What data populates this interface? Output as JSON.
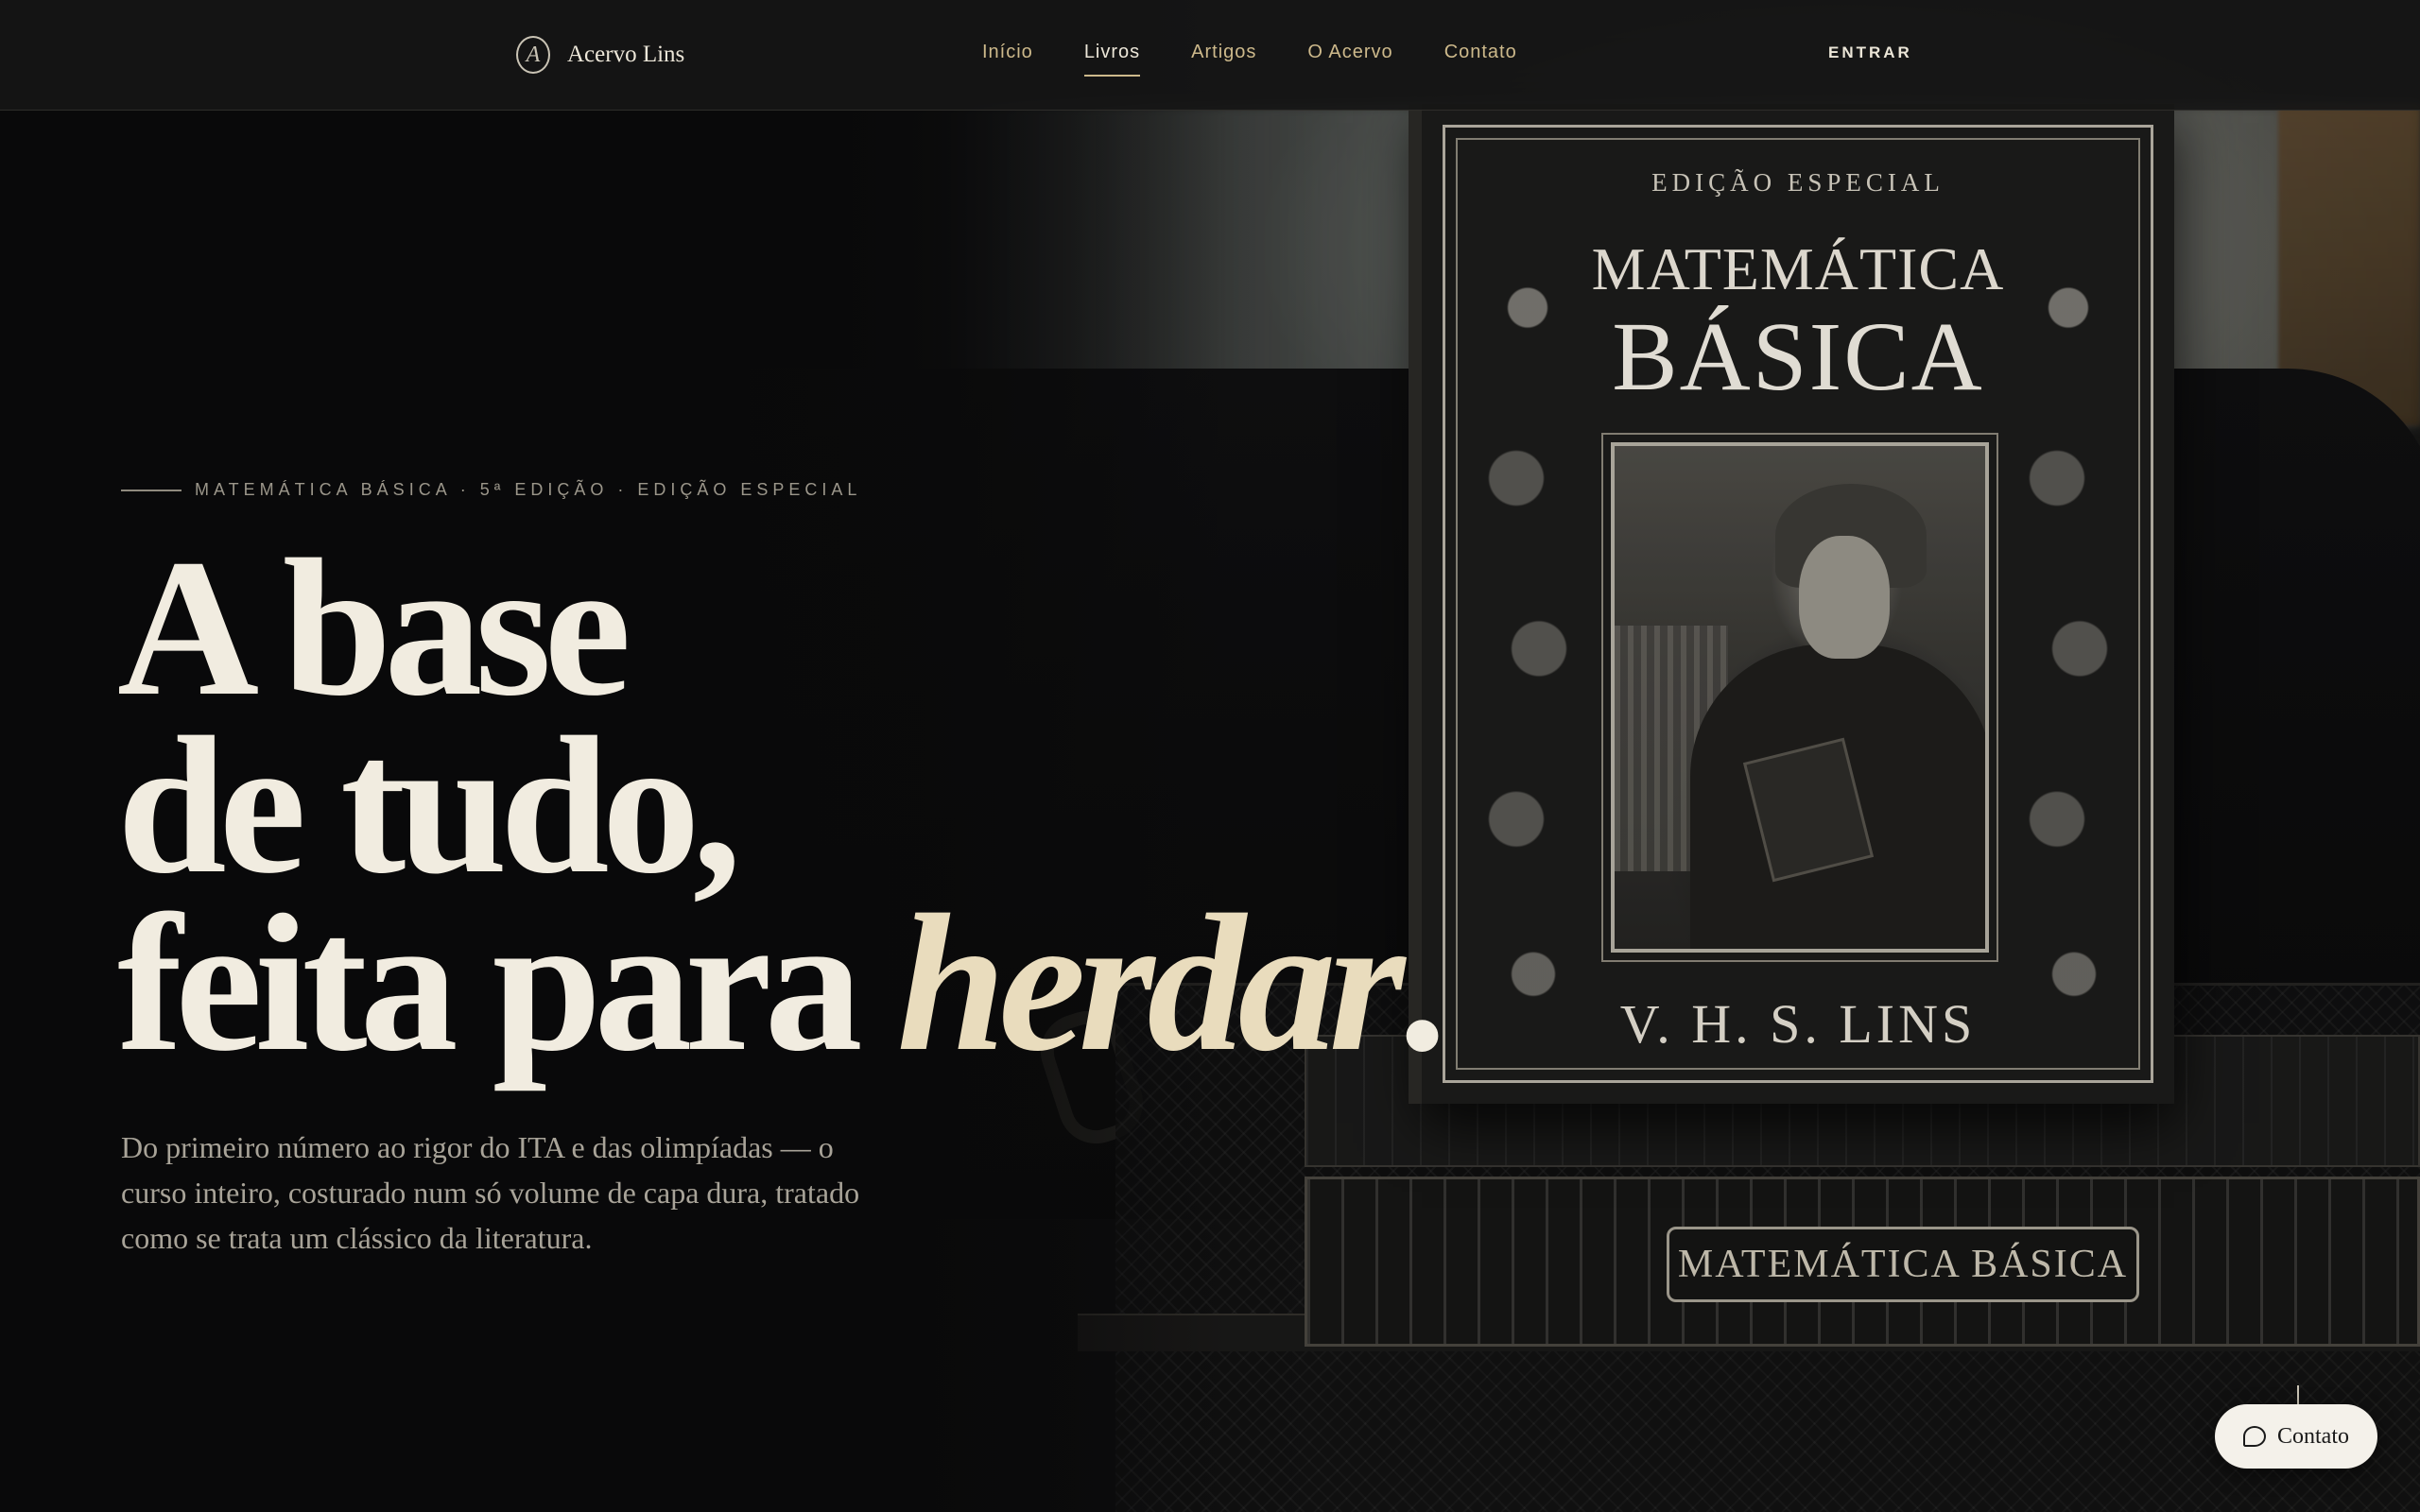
{
  "header": {
    "brand_name": "Acervo Lins",
    "nav": [
      {
        "label": "Início",
        "active": false
      },
      {
        "label": "Livros",
        "active": true
      },
      {
        "label": "Artigos",
        "active": false
      },
      {
        "label": "O Acervo",
        "active": false
      },
      {
        "label": "Contato",
        "active": false
      }
    ],
    "login_label": "ENTRAR"
  },
  "hero": {
    "eyebrow": "MATEMÁTICA BÁSICA · 5ª EDIÇÃO · EDIÇÃO ESPECIAL",
    "headline_line1": "A base",
    "headline_line2": "de tudo,",
    "headline_line3_plain": "feita para ",
    "headline_line3_italic": "herdar",
    "headline_line3_end": ".",
    "lead": "Do primeiro número ao rigor do ITA e das olimpíadas — o curso inteiro, costurado num só volume de capa dura, tratado como se trata um clássico da literatura."
  },
  "book_cover": {
    "eyebrow": "EDIÇÃO ESPECIAL",
    "title_line1": "MATEMÁTICA",
    "title_line2": "BÁSICA",
    "author": "V. H. S. LINS",
    "spine_label": "MATEMÁTICA BÁSICA"
  },
  "contact_button": {
    "label": "Contato",
    "icon": "chat-bubble-icon"
  },
  "colors": {
    "background": "#0b0b0c",
    "accent_gold": "#cdb98b",
    "cream": "#f1ece0",
    "fab_bg": "#f4f1ea"
  }
}
